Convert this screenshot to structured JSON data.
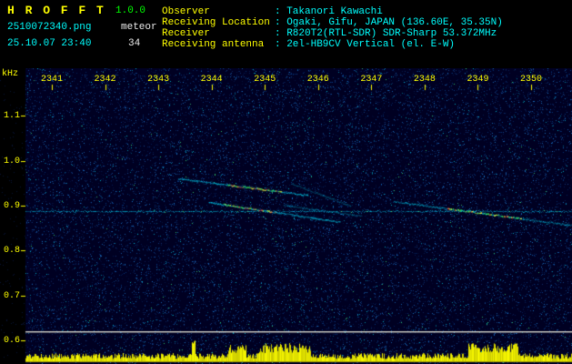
{
  "header": {
    "title": "H R O F F T",
    "version": "1.0.0",
    "filename": "2510072340.png",
    "mode": "meteor",
    "timestamp": "25.10.07 23:40",
    "echo_count": "34",
    "info": [
      {
        "label": "Observer",
        "value": ": Takanori Kawachi"
      },
      {
        "label": "Receiving Location",
        "value": ": Ogaki, Gifu, JAPAN (136.60E, 35.35N)"
      },
      {
        "label": "Receiver",
        "value": ": R820T2(RTL-SDR) SDR-Sharp 53.372MHz"
      },
      {
        "label": "Receiving antenna",
        "value": ": 2el-HB9CV Vertical (el. E-W)"
      }
    ]
  },
  "palette": {
    "title_text": "#ffff00",
    "version_text": "#00ff00",
    "cyan_text": "#00ffff",
    "white_text": "#ececec",
    "axis_text": "#ffff00"
  },
  "chart_data": {
    "type": "heatmap",
    "subtype": "radio-meteor-spectrogram",
    "title": "",
    "xlabel": "",
    "ylabel": "kHz",
    "x_ticks": [
      "2341",
      "2342",
      "2343",
      "2344",
      "2345",
      "2346",
      "2347",
      "2348",
      "2349",
      "2350"
    ],
    "y_ticks": [
      "1.1",
      "1.0",
      "0.9",
      "0.8",
      "0.7",
      "0.6"
    ],
    "ylim_khz": [
      0.55,
      1.15
    ],
    "time_span_hhmm": [
      "2340",
      "2350"
    ],
    "carrier_khz": 0.888,
    "baseline_khz": 0.62,
    "echo_trails": [
      {
        "t_start": 3.37,
        "f_start": 0.961,
        "t_end": 5.8,
        "f_end": 0.924,
        "intensity": "strong",
        "hot_from": 4.3,
        "hot_to": 5.3
      },
      {
        "t_start": 3.95,
        "f_start": 0.908,
        "t_end": 6.4,
        "f_end": 0.864,
        "intensity": "strong",
        "hot_from": 4.2,
        "hot_to": 5.2
      },
      {
        "t_start": 5.35,
        "f_start": 0.902,
        "t_end": 6.8,
        "f_end": 0.878,
        "intensity": "weak",
        "hot_from": 0,
        "hot_to": 0
      },
      {
        "t_start": 5.5,
        "f_start": 0.95,
        "t_end": 6.6,
        "f_end": 0.9,
        "intensity": "weak",
        "hot_from": 0,
        "hot_to": 0
      },
      {
        "t_start": 7.42,
        "f_start": 0.91,
        "t_end": 10.8,
        "f_end": 0.856,
        "intensity": "medium",
        "hot_from": 8.4,
        "hot_to": 9.8
      }
    ],
    "noise_bar": {
      "position": "bottom",
      "color": "#ffff00",
      "spike_regions_t": [
        [
          4.3,
          4.65
        ],
        [
          4.89,
          5.85
        ],
        [
          8.82,
          9.76
        ]
      ],
      "tall_spike_t": 3.66
    },
    "colors": {
      "background": "#000022",
      "trail": "#00c8e8",
      "hot": [
        "#40ff60",
        "#ffff40",
        "#ff8030",
        "#ff4040"
      ],
      "axis": "#ffff00",
      "baseline": "#e6e6d7",
      "noise_bar": "#ffff00"
    }
  }
}
